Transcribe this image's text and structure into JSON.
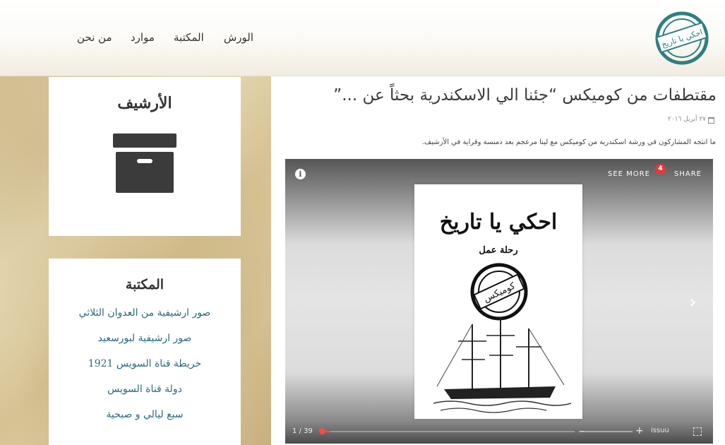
{
  "header": {
    "logo_text": "احكي يا تاريخ",
    "nav": [
      {
        "label": "الورش"
      },
      {
        "label": "المكتبة"
      },
      {
        "label": "موارد"
      },
      {
        "label": "من نحن"
      }
    ]
  },
  "sidebar": {
    "archive": {
      "title": "الأرشيف",
      "icon": "archive-box-icon"
    },
    "library": {
      "title": "المكتبة",
      "links": [
        "صور ارشيفية من العدوان الثلاثي",
        "صور ارشيفية لبورسعيد",
        "خريطة قناة السويس 1921",
        "دولة قناة السويس",
        "سبع ليالي و صبحية"
      ]
    }
  },
  "post": {
    "title": "مقتطفات من كوميكس “جئنا الي الاسكندرية بحثاً عن ...”",
    "date": "٢٧ أبريل ٢٠١٦",
    "excerpt": "ما انتجه المشاركون في ورشة اسكندرية من كوميكس مع لينا مرعجم بعد دمنسة وقراية في الأرشيف."
  },
  "viewer": {
    "info_label": "i",
    "see_more_label": "SEE MORE",
    "badge_count": "4",
    "share_label": "SHARE",
    "page_title": "احكي يا تاريخ",
    "page_subtitle": "رحلة عمل",
    "stamp_text": "كوميكس",
    "page_counter": "1 / 39",
    "progress": 0.04,
    "issuu_label": "issuu",
    "next_glyph": "›"
  },
  "colors": {
    "link": "#2b6a7c",
    "accent_red": "#e23b3b",
    "stamp_teal": "#2f7f80"
  }
}
